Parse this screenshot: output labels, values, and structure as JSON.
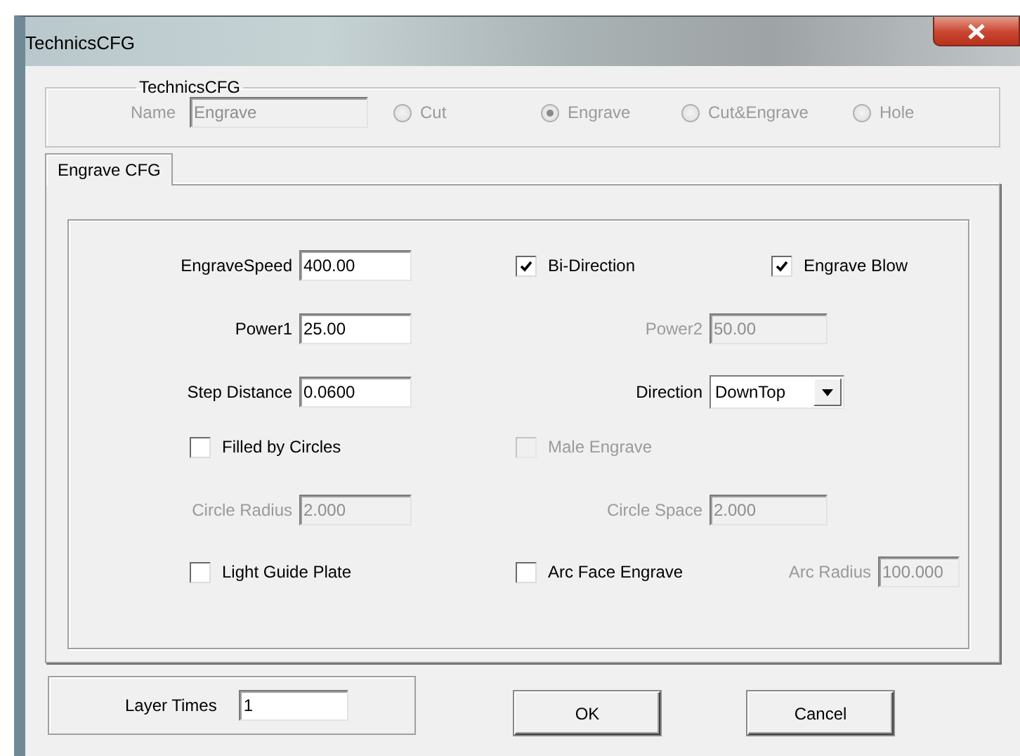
{
  "window": {
    "title": "TechnicsCFG"
  },
  "group": {
    "title": "TechnicsCFG",
    "name_label": "Name",
    "name_value": "Engrave",
    "disabled": true,
    "modes": [
      {
        "label": "Cut",
        "selected": false
      },
      {
        "label": "Engrave",
        "selected": true
      },
      {
        "label": "Cut&Engrave",
        "selected": false
      },
      {
        "label": "Hole",
        "selected": false
      }
    ]
  },
  "tabs": [
    {
      "label": "Engrave CFG",
      "selected": true
    }
  ],
  "rows": [
    [
      {
        "kind": "field",
        "label": "EngraveSpeed",
        "value": "400.00",
        "disabled": false
      },
      {
        "kind": "checkbox",
        "label": "Bi-Direction",
        "checked": true,
        "disabled": false
      },
      {
        "kind": "checkbox",
        "label": "Engrave Blow",
        "checked": true,
        "disabled": false
      }
    ],
    [
      {
        "kind": "field",
        "label": "Power1",
        "value": "25.00",
        "disabled": false
      },
      {
        "kind": "field",
        "label": "Power2",
        "value": "50.00",
        "disabled": true
      }
    ],
    [
      {
        "kind": "field",
        "label": "Step Distance",
        "value": "0.0600",
        "disabled": false
      },
      {
        "kind": "dropdown",
        "label": "Direction",
        "value": "DownTop"
      }
    ],
    [
      {
        "kind": "checkbox",
        "label": "Filled by Circles",
        "checked": false,
        "disabled": false
      },
      {
        "kind": "checkbox",
        "label": "Male Engrave",
        "checked": false,
        "disabled": true
      }
    ],
    [
      {
        "kind": "field",
        "label": "Circle Radius",
        "value": "2.000",
        "disabled": true
      },
      {
        "kind": "field",
        "label": "Circle Space",
        "value": "2.000",
        "disabled": true
      }
    ],
    [
      {
        "kind": "checkbox",
        "label": "Light Guide Plate",
        "checked": false,
        "disabled": false
      },
      {
        "kind": "checkbox",
        "label": "Arc Face Engrave",
        "checked": false,
        "disabled": false
      },
      {
        "kind": "field",
        "label": "Arc Radius",
        "value": "100.000",
        "disabled": true
      }
    ]
  ],
  "layer": {
    "label": "Layer Times",
    "value": "1"
  },
  "buttons": [
    "OK",
    "Cancel"
  ]
}
